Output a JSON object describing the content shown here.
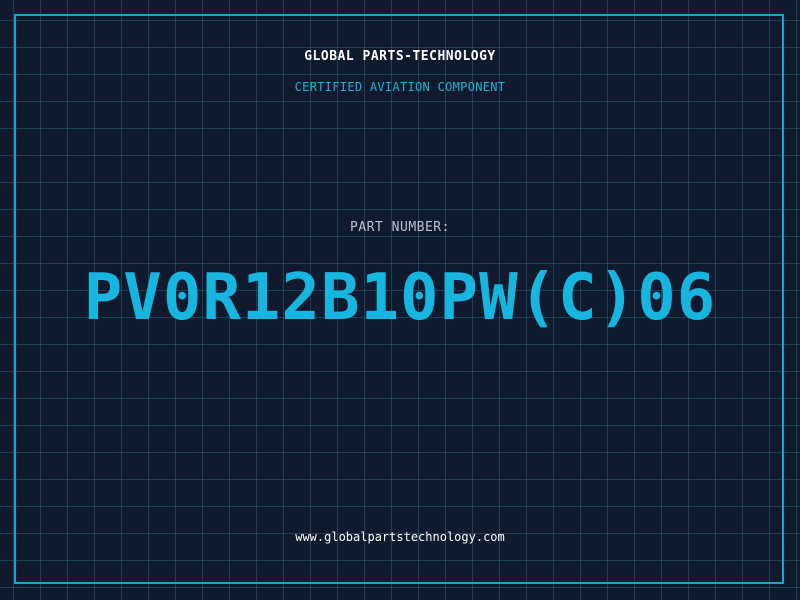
{
  "header": {
    "company": "GLOBAL PARTS-TECHNOLOGY",
    "subtitle": "CERTIFIED AVIATION COMPONENT"
  },
  "part": {
    "label": "PART NUMBER:",
    "number": "PV0R12B10PW(C)06"
  },
  "footer": {
    "url": "www.globalpartstechnology.com"
  },
  "colors": {
    "background": "#0f1a2e",
    "grid": "#2b5e78",
    "accent": "#16b6e0",
    "frame": "#1aa3c7"
  }
}
